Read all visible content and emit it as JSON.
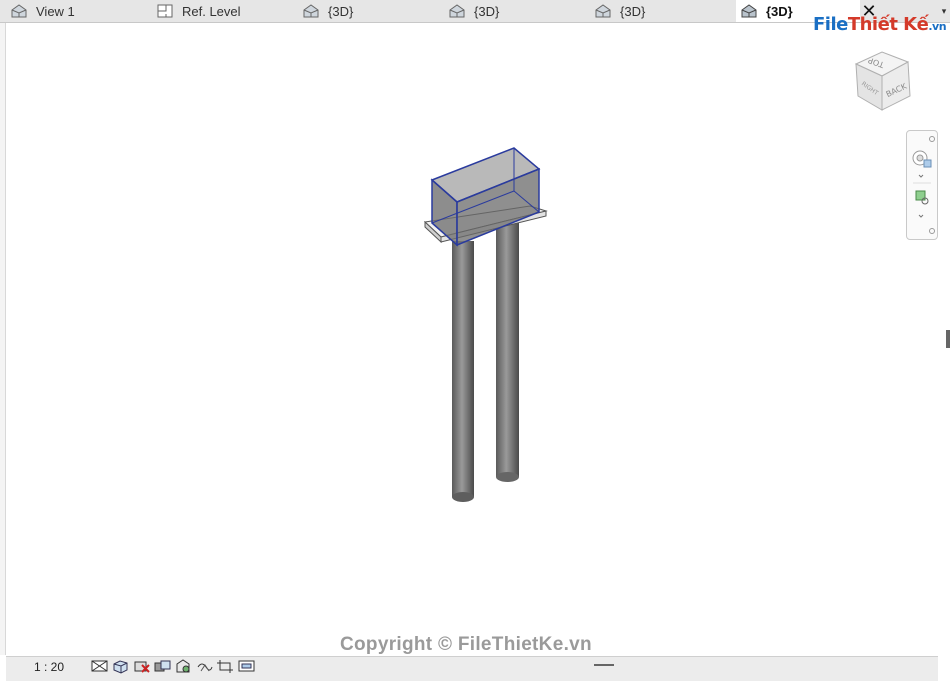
{
  "tabs": [
    {
      "label": "View 1",
      "icon": "3d-house-icon",
      "active": false
    },
    {
      "label": "Ref. Level",
      "icon": "floor-plan-icon",
      "active": false
    },
    {
      "label": "{3D}",
      "icon": "3d-house-icon",
      "active": false
    },
    {
      "label": "{3D}",
      "icon": "3d-house-icon",
      "active": false
    },
    {
      "label": "{3D}",
      "icon": "3d-house-icon",
      "active": false
    },
    {
      "label": "{3D}",
      "icon": "3d-house-icon",
      "active": true
    }
  ],
  "close_glyph": "✕",
  "overflow_glyph": "▾",
  "watermark_logo": {
    "part1": "File",
    "part2": "Thiết Kế",
    "part3": ".vn"
  },
  "viewcube": {
    "faces": [
      "TOP",
      "RIGHT",
      "BACK"
    ]
  },
  "status": {
    "scale": "1 : 20"
  },
  "copyright": "Copyright © FileThietKe.vn",
  "colors": {
    "selection": "#2a3b9e",
    "pile": "#7a7a7a",
    "tabbar": "#e6e6e6"
  }
}
